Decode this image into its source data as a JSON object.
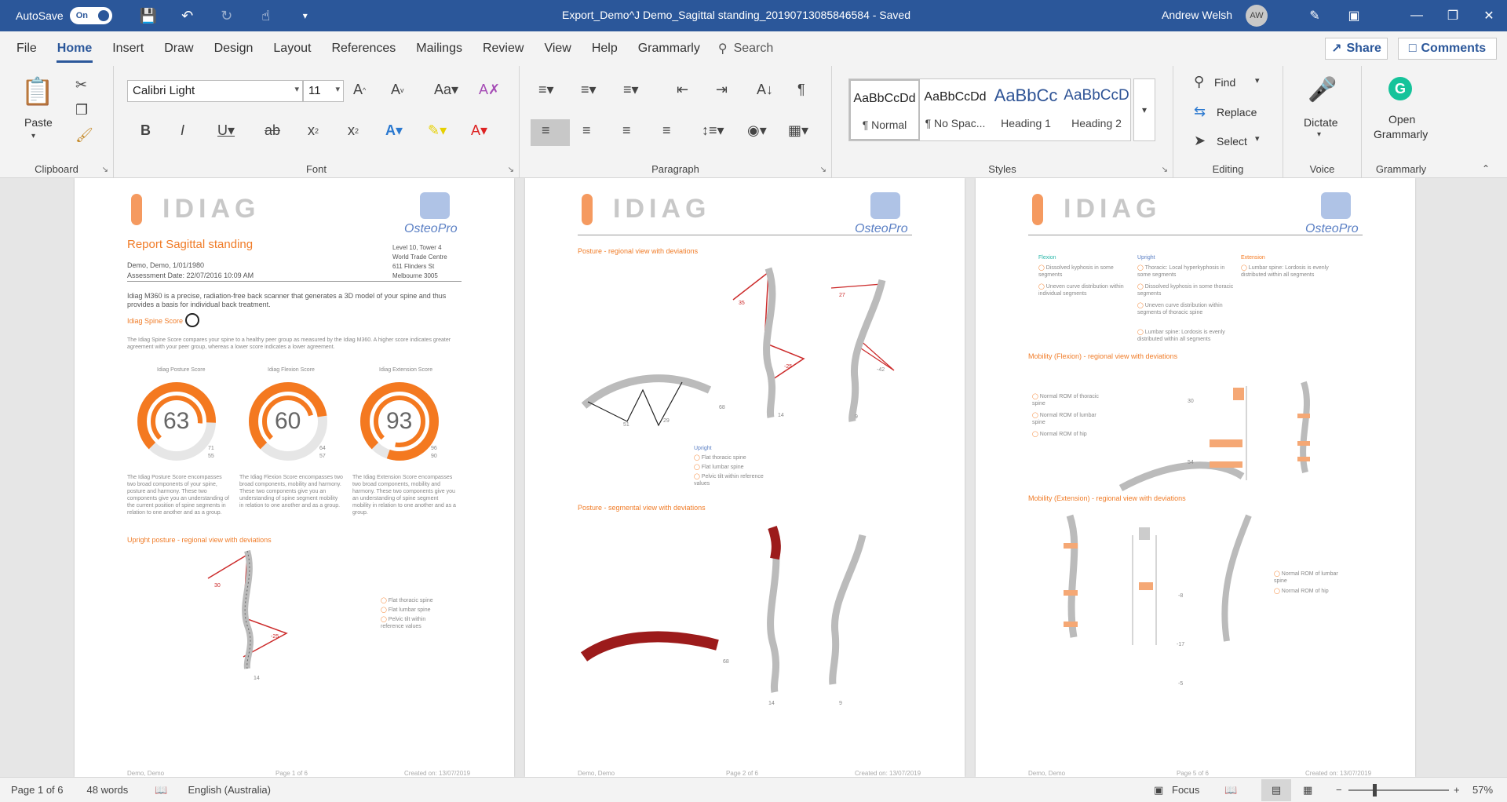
{
  "titlebar": {
    "autosave_label": "AutoSave",
    "autosave_state": "On",
    "doc_title": "Export_Demo^J Demo_Sagittal standing_20190713085846584  -  Saved",
    "user_name": "Andrew Welsh",
    "user_initials": "AW"
  },
  "tabs": [
    "File",
    "Home",
    "Insert",
    "Draw",
    "Design",
    "Layout",
    "References",
    "Mailings",
    "Review",
    "View",
    "Help",
    "Grammarly"
  ],
  "search": {
    "label": "Search"
  },
  "share": {
    "label": "Share"
  },
  "comments": {
    "label": "Comments"
  },
  "ribbon": {
    "clipboard": {
      "paste": "Paste",
      "label": "Clipboard"
    },
    "font": {
      "name": "Calibri Light",
      "size": "11",
      "label": "Font"
    },
    "paragraph": {
      "label": "Paragraph"
    },
    "styles": {
      "label": "Styles",
      "items": [
        {
          "sample": "AaBbCcDd",
          "name": "¶ Normal"
        },
        {
          "sample": "AaBbCcDd",
          "name": "¶ No Spac..."
        },
        {
          "sample": "AaBbCc",
          "name": "Heading 1"
        },
        {
          "sample": "AaBbCcD",
          "name": "Heading 2"
        }
      ]
    },
    "editing": {
      "label": "Editing",
      "find": "Find",
      "replace": "Replace",
      "select": "Select"
    },
    "voice": {
      "label": "Voice",
      "dictate": "Dictate"
    },
    "grammarly": {
      "label": "Grammarly",
      "open1": "Open",
      "open2": "Grammarly"
    }
  },
  "page1": {
    "logo": "IDIAG",
    "osteo": "OsteoPro",
    "report_title": "Report Sagittal standing",
    "patient": "Demo, Demo, 1/01/1980",
    "assessment": "Assessment Date: 22/07/2016 10:09 AM",
    "address": [
      "Level 10, Tower 4",
      "World Trade Centre",
      "611 Flinders St",
      "Melbourne 3005"
    ],
    "intro": "Idiag M360 is a precise, radiation-free back scanner that generates a 3D model of your spine and thus provides a basis for individual back treatment.",
    "spine_score_heading": "Idiag Spine Score",
    "spine_score_desc": "The Idiag Spine Score compares your spine to a healthy peer group as measured by the Idiag M360. A higher score indicates greater agreement with your peer group, whereas a lower score indicates a lower agreement.",
    "gauges": [
      {
        "title": "Idiag Posture Score",
        "value": "63",
        "sub1": "71",
        "sub2": "55",
        "desc": "The Idiag Posture Score encompasses two broad components of your spine, posture and harmony. These two components give you an understanding of the current position of spine segments in relation to one another and as a group."
      },
      {
        "title": "Idiag Flexion Score",
        "value": "60",
        "sub1": "64",
        "sub2": "57",
        "desc": "The Idiag Flexion Score encompasses two broad components, mobility and harmony. These two components give you an understanding of spine segment mobility in relation to one another and as a group."
      },
      {
        "title": "Idiag Extension Score",
        "value": "93",
        "sub1": "96",
        "sub2": "90",
        "desc": "The Idiag Extension Score encompasses two broad components, mobility and harmony. These two components give you an understanding of spine segment mobility in relation to one another and as a group."
      }
    ],
    "upright_heading": "Upright posture - regional view with deviations",
    "upright_items": [
      "Flat thoracic spine",
      "Flat lumbar spine",
      "Pelvic tilt within reference values"
    ],
    "angle1": "30",
    "angle2": "-25",
    "angle3": "14",
    "footer_left": "Demo, Demo",
    "footer_mid": "Page 1 of 6",
    "footer_right": "Created on: 13/07/2019"
  },
  "page2": {
    "heading1": "Posture - regional view with deviations",
    "upright_label": "Upright",
    "items": [
      "Flat thoracic spine",
      "Flat lumbar spine",
      "Pelvic tilt within reference values"
    ],
    "heading2": "Posture - segmental view with deviations",
    "angles": [
      "35",
      "-25",
      "51",
      "29",
      "68",
      "14",
      "27",
      "-42",
      "9",
      "68",
      "14",
      "9"
    ],
    "footer_left": "Demo, Demo",
    "footer_mid": "Page 2 of 6",
    "footer_right": "Created on: 13/07/2019"
  },
  "page3": {
    "flexion_label": "Flexion",
    "upright_label": "Upright",
    "extension_label": "Extension",
    "flexion_items": [
      "Dissolved kyphosis in some segments",
      "Uneven curve distribution within individual segments"
    ],
    "upright_items": [
      "Thoracic: Local hyperkyphosis in some segments",
      "Dissolved kyphosis in some thoracic segments",
      "Uneven curve distribution within segments of thoracic spine",
      "Lumbar spine: Lordosis is evenly distributed within all segments"
    ],
    "extension_items": [
      "Lumbar spine: Lordosis is evenly distributed within all segments"
    ],
    "mob_flex_heading": "Mobility (Flexion) - regional view with deviations",
    "mob_flex_items": [
      "Normal ROM of thoracic spine",
      "Normal ROM of lumbar spine",
      "Normal ROM of hip"
    ],
    "mob_ext_heading": "Mobility (Extension) - regional view with deviations",
    "mob_ext_items": [
      "Normal ROM of lumbar spine",
      "Normal ROM of hip"
    ],
    "vals": [
      "30",
      "54",
      "-8",
      "-17",
      "-5"
    ],
    "footer_left": "Demo, Demo",
    "footer_mid": "Page 5 of 6",
    "footer_right": "Created on: 13/07/2019"
  },
  "status": {
    "page": "Page 1 of 6",
    "words": "48 words",
    "language": "English (Australia)",
    "focus": "Focus",
    "zoom": "57%"
  }
}
